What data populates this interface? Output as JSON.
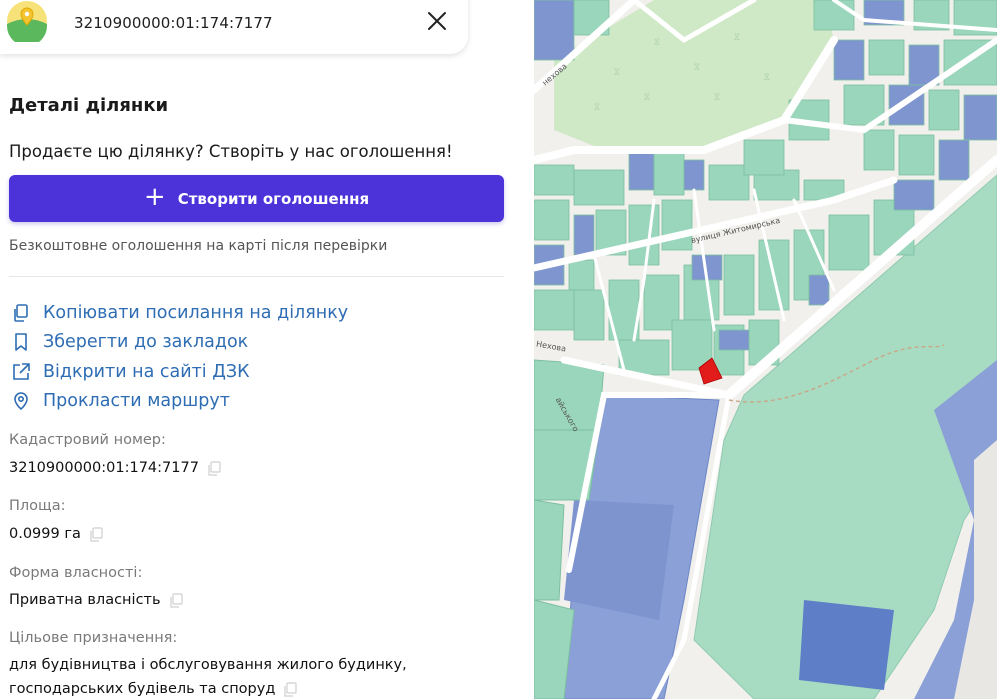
{
  "search": {
    "value": "3210900000:01:174:7177"
  },
  "panel": {
    "title": "Деталі ділянки",
    "promo": "Продаєте цю ділянку? Створіть у нас оголошення!",
    "create_button": "Створити оголошення",
    "free_note": "Безкоштовне оголошення на карті після перевірки",
    "actions": [
      {
        "label": "Копіювати посилання на ділянку",
        "icon": "copy-link-icon"
      },
      {
        "label": "Зберегти до закладок",
        "icon": "bookmark-icon"
      },
      {
        "label": "Відкрити на сайті ДЗК",
        "icon": "external-link-icon"
      },
      {
        "label": "Прокласти маршрут",
        "icon": "location-pin-icon"
      }
    ],
    "fields": {
      "cadastral_label": "Кадастровий номер:",
      "cadastral_value": "3210900000:01:174:7177",
      "area_label": "Площа:",
      "area_value": "0.0999 га",
      "ownership_label": "Форма власності:",
      "ownership_value": "Приватна власність",
      "purpose_label": "Цільове призначення:",
      "purpose_value_line1": "для будівництва і обслуговування жилого будинку,",
      "purpose_value_line2": "господарських будівель та споруд"
    }
  },
  "map": {
    "street_labels": {
      "zhytomyrska": "вулиця Житомирська",
      "top_left": "нехова",
      "middle_left": "Нехова",
      "lower_left": "айського"
    }
  },
  "colors": {
    "accent": "#4b33d9",
    "link": "#2e6db4",
    "parcel_green": "#8fd1b3",
    "parcel_blue": "#7f95cf",
    "selected_parcel": "#e21b1b"
  }
}
